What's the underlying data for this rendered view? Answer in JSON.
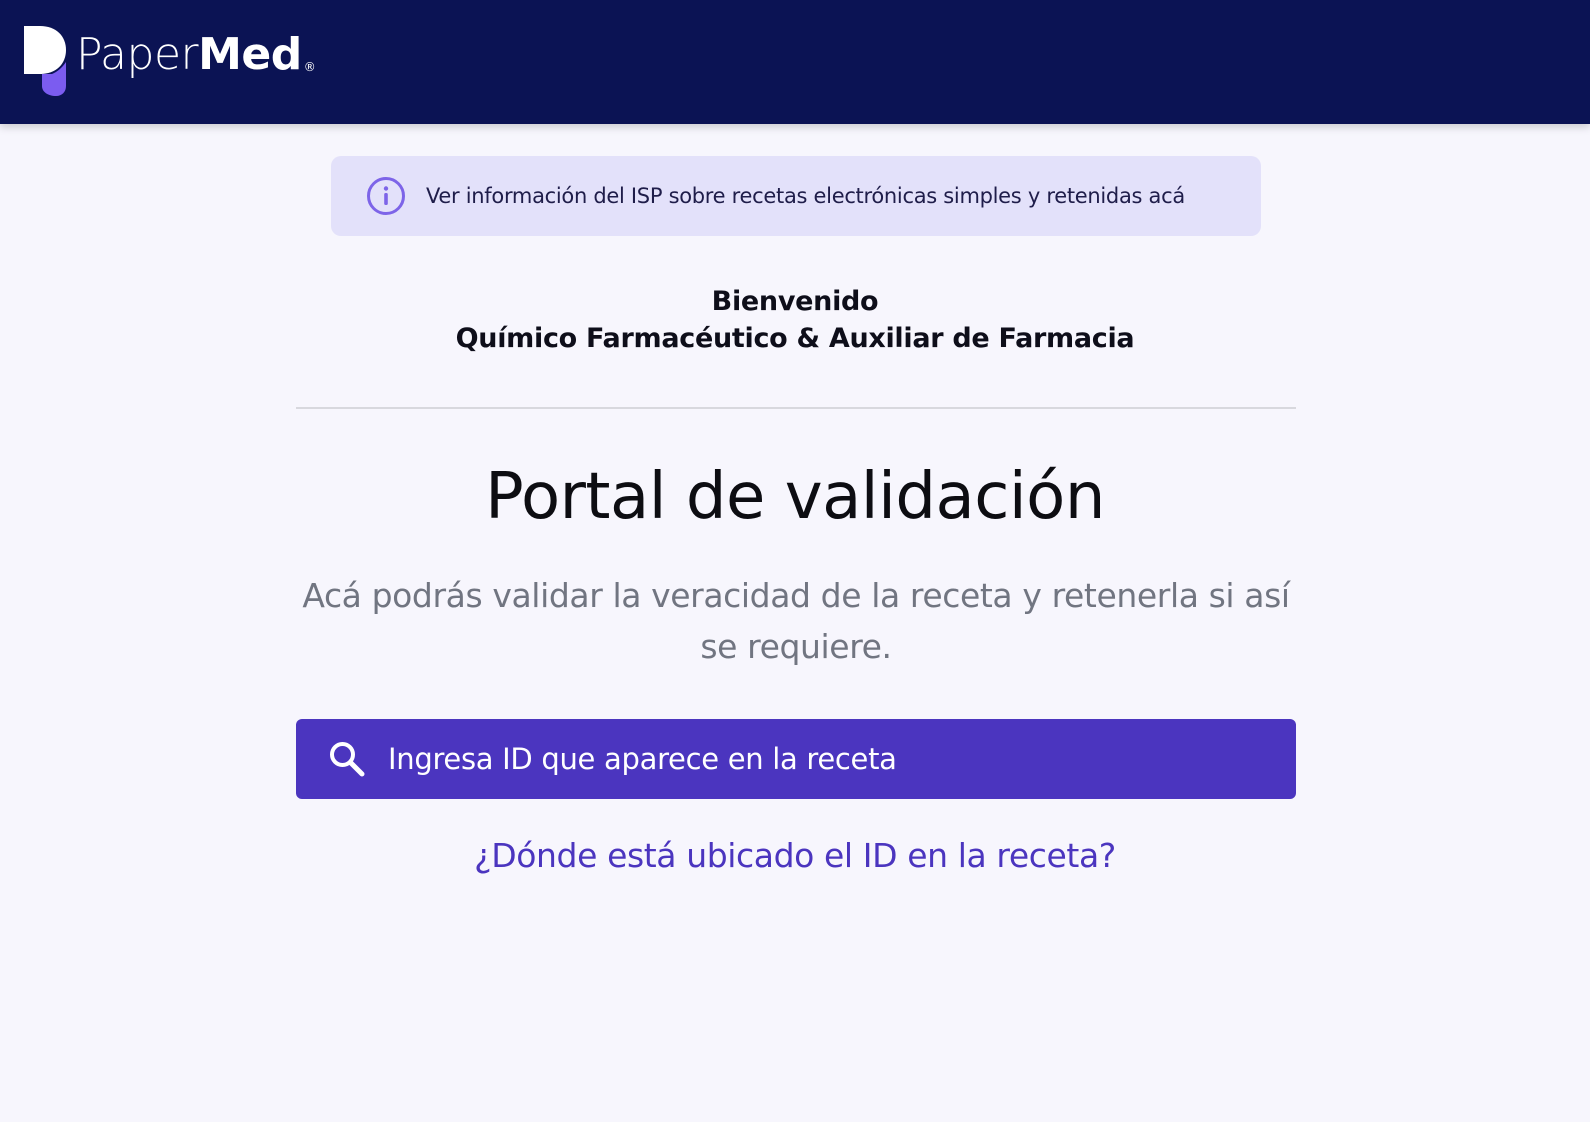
{
  "header": {
    "brand_light": "Paper",
    "brand_bold": "Med",
    "brand_mark": "®"
  },
  "info_banner": {
    "icon": "info-icon",
    "text": "Ver información del ISP sobre recetas electrónicas simples y retenidas acá"
  },
  "welcome": {
    "line1": "Bienvenido",
    "line2": "Químico Farmacéutico & Auxiliar de Farmacia"
  },
  "portal": {
    "title": "Portal de validación",
    "subtitle": "Acá podrás validar la veracidad de la receta y retenerla si así se requiere."
  },
  "search": {
    "icon": "search-icon",
    "value": "",
    "placeholder": "Ingresa ID que aparece en la receta"
  },
  "help_link": {
    "text": "¿Dónde está ubicado el ID en la receta?"
  },
  "colors": {
    "header_bg": "#0b1354",
    "page_bg": "#f7f6fd",
    "accent": "#4b35bf",
    "banner_bg": "#e3e1fa",
    "logo_accent": "#7b5cf0"
  }
}
